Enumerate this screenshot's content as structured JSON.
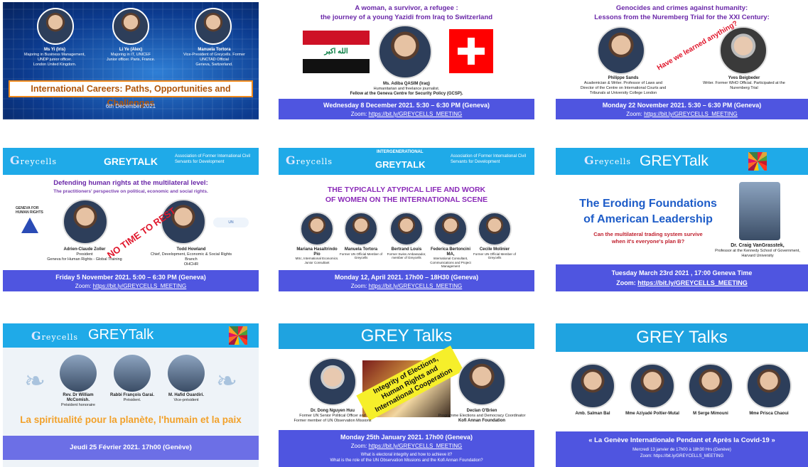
{
  "tiles": {
    "t1": {
      "people": [
        {
          "name": "Ms Yi (Iris)",
          "role": "Majoring in Business Management, UNDP junior officer.",
          "place": "London United Kingdom."
        },
        {
          "name": "Li Ye (Alex)",
          "role": "Majoring in IT, UNICEF",
          "place": "Junior officer. Paris, France."
        },
        {
          "name": "Manuela Tortora",
          "role": "Vice-President of Greycells. Former UNCTAD Official",
          "place": "Geneva, Switzerland."
        }
      ],
      "title": "International Careers: Paths, Opportunities and Challenges",
      "date": "6th December 2021"
    },
    "t2": {
      "title_line1": "A woman, a survivor, a refugee :",
      "title_line2": "the journey of a young Yazidi from Iraq to Switzerland",
      "caption1": "Ms. Adiba QASIM (Iraq)",
      "caption2": "Humanitarian and freelance journalist.",
      "caption3": "Fellow at the Geneva Centre for Security Policy (GCSP).",
      "when": "Wednesday 8 December 2021. 5:30 – 6:30 PM (Geneva)",
      "zoom_label": "Zoom:",
      "zoom_link": "https://bit.ly/GREYCELLS_MEETING",
      "colors": {
        "iraq_red": "#ce1126",
        "iraq_green": "#007a3d",
        "swiss_red": "#ff0000"
      }
    },
    "t3": {
      "title_line1": "Genocides and crimes against humanity:",
      "title_line2": "Lessons from the Nuremberg Trial for the XXI Century:",
      "stamp": "Have we learned anything?",
      "p1_name": "Philippe Sands",
      "p1_role": "Academician & Writer. Professor of Laws and Director of the Centre on International Courts and Tribunals at University College London",
      "p2_name": "Yves Beigbeder",
      "p2_role": "Writer. Former WHO Official. Participated at the Nuremberg Trial",
      "when": "Monday   22 November 2021. 5:30 – 6:30 PM (Geneva)",
      "zoom_label": "Zoom:",
      "zoom_link": "https://bit.ly/GREYCELLS_MEETING"
    },
    "t4": {
      "logo": "reycells",
      "header": "GREYTALK",
      "assoc": "Association of Former International Civil Servants for Development",
      "title": "Defending human rights at the multilateral level:",
      "subtitle": "The practitioners' perspective on political, economic and social rights.",
      "org": "GENEVA FOR HUMAN RIGHTS",
      "stamp": "NO TIME TO REST",
      "p1_name": "Adrien-Claude Zoller",
      "p1_role": "President",
      "p1_org": "Geneva for Human Rights - Global Training",
      "p2_name": "Todd Howland",
      "p2_role": "Chief, Development, Economic & Social Rights Branch",
      "p2_org": "OHCHR",
      "when": "Friday 5 November 2021. 5:00 – 6:30 PM (Geneva)",
      "zoom_label": "Zoom:",
      "zoom_link": "https://bit.ly/GREYCELLS_MEETING"
    },
    "t5": {
      "logo": "reycells",
      "kicker": "INTERGENERATIONAL",
      "header": "GREYTALK",
      "assoc": "Association of Former International Civil Servants for Development",
      "title_line1": "THE TYPICALLY ATYPICAL LIFE AND WORK",
      "title_line2": "OF WOMEN ON THE INTERNATIONAL SCENE",
      "people": [
        {
          "name": "Mariana Hasaltrindo Pio",
          "role": "MSc, International Economics. Junior Consultant"
        },
        {
          "name": "Manuela Tortora",
          "role": "Former UN Official Member of Greycells"
        },
        {
          "name": "Bertrand Louis",
          "role": "Former Swiss Ambassador, member of Greycells"
        },
        {
          "name": "Federica Bertoncini MA,",
          "role": "International Consultant, Communications and Project Management"
        },
        {
          "name": "Cecile Molinier",
          "role": "Former UN Official Member of Greycells"
        }
      ],
      "when": "Monday 12, April 2021. 17h00 – 18H30 (Geneva)",
      "zoom_label": "Zoom:",
      "zoom_link": "https://bit.ly/GREYCELLS_MEETING"
    },
    "t6": {
      "logo": "reycells",
      "header": "GREYTalk",
      "title_line1": "The Eroding Foundations",
      "title_line2": "of American Leadership",
      "sub_line1": "Can the multilateral trading system survive",
      "sub_line2": "when it's everyone's plan B?",
      "speaker": "Dr. Craig VanGrasstek,",
      "speaker_role": "Professor at the Kennedy School of Government, Harvard University",
      "when": "Tuesday March 23rd 2021 , 17:00 Geneva Time",
      "zoom_label": "Zoom:",
      "zoom_link": "https://bit.ly/GREYCELLS_MEETING"
    },
    "t7": {
      "logo": "reycells",
      "header": "GREYTalk",
      "people": [
        {
          "name": "Rev. Dr William McComish.",
          "role": "Président honoraire"
        },
        {
          "name": "Rabbi François Garai.",
          "role": "Président."
        },
        {
          "name": "M. Hafid Ouardiri.",
          "role": "Vice-président"
        }
      ],
      "title": "La spiritualité pour la planète, l'humain et la paix",
      "when": "Jeudi 25 Février 2021. 17h00 (Genève)"
    },
    "t8": {
      "header": "GREY Talks",
      "stamp_line1": "Integrity of Elections,",
      "stamp_line2": "Human Rights and",
      "stamp_line3": "International Cooperation",
      "p1_name": "Dr. Dong Nguyen Huu",
      "p1_role1": "Former UN Senior Political Officer and",
      "p1_role2": "Former member of UN Observation Missions",
      "p2_name": "Declan O'Brien",
      "p2_role1": "Programme Elections and Democracy Coordinator",
      "p2_role2": "Kofi Annan Foundation",
      "when": "Monday 25th January 2021. 17h00 (Geneva)",
      "zoom_label": "Zoom:",
      "zoom_link": "https://bit.ly/GREYCELLS_MEETING",
      "q1": "What is electoral integrity and how to achieve it?",
      "q2": "What is the role of the UN Observation Missions and the Kofi Annan Foundation?"
    },
    "t9": {
      "header": "GREY Talks",
      "people": [
        {
          "name": "Amb. Salman Bal"
        },
        {
          "name": "Mme Aziyadé Poltier-Mutal"
        },
        {
          "name": "M Serge Mimouni"
        },
        {
          "name": "Mme Prisca Chaoui"
        }
      ],
      "title": "« La Genève Internationale Pendant et Après la Covid-19 »",
      "when": "Mercredi 13 janvier de 17h00 à 18h30 Hrs (Genève)",
      "zoom": "Zoom: https://bit.ly/GREYCELLS_MEETING"
    }
  }
}
